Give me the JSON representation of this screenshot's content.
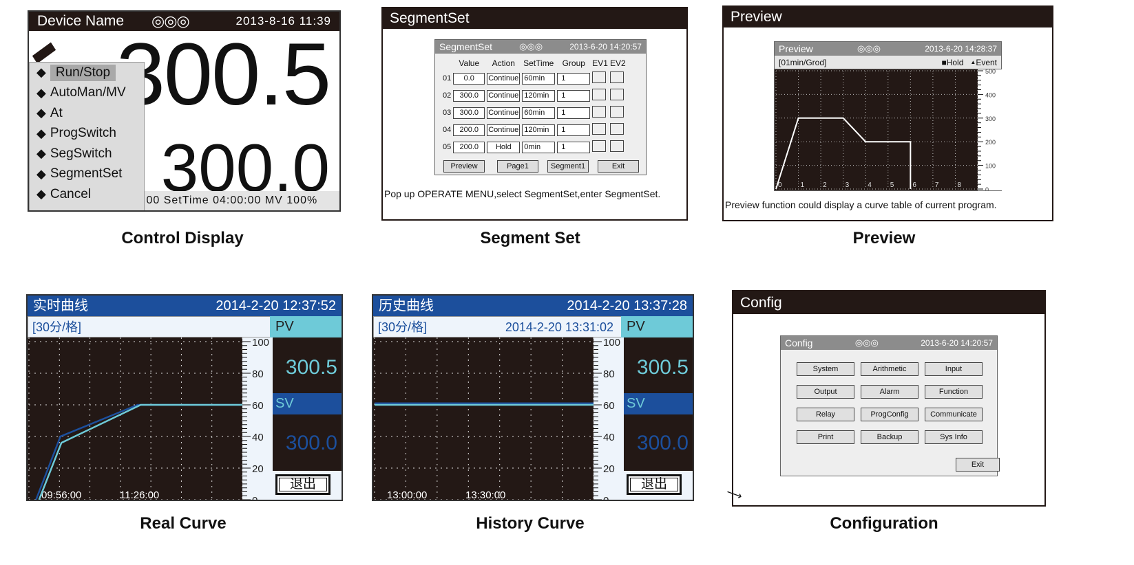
{
  "control_display": {
    "device_name": "Device Name",
    "status_icons": "◎◎◎",
    "datetime": "2013-8-16 11:39",
    "pv": "300.5",
    "sv": "300.0",
    "status_line": ":00  SetTime 04:00:00  MV 100%",
    "menu_items": [
      "Run/Stop",
      "AutoMan/MV",
      "At",
      "ProgSwitch",
      "SegSwitch",
      "SegmentSet",
      "Cancel"
    ],
    "selected_item": "Run/Stop",
    "caption": "Control Display"
  },
  "segment_set": {
    "window_title": "SegmentSet",
    "dialog_title": "SegmentSet",
    "status_icons": "◎◎◎",
    "datetime": "2013-6-20 14:20:57",
    "columns": [
      "",
      "Value",
      "Action",
      "SetTime",
      "Group",
      "EV1",
      "EV2"
    ],
    "rows": [
      {
        "no": "01",
        "value": "0.0",
        "action": "Continue",
        "settime": "60min",
        "group": "1",
        "ev1": false,
        "ev2": false
      },
      {
        "no": "02",
        "value": "300.0",
        "action": "Continue",
        "settime": "120min",
        "group": "1",
        "ev1": false,
        "ev2": false
      },
      {
        "no": "03",
        "value": "300.0",
        "action": "Continue",
        "settime": "60min",
        "group": "1",
        "ev1": false,
        "ev2": false
      },
      {
        "no": "04",
        "value": "200.0",
        "action": "Continue",
        "settime": "120min",
        "group": "1",
        "ev1": false,
        "ev2": false
      },
      {
        "no": "05",
        "value": "200.0",
        "action": "Hold",
        "settime": "0min",
        "group": "1",
        "ev1": false,
        "ev2": false
      }
    ],
    "buttons": [
      "Preview",
      "Page1",
      "Segment1",
      "Exit"
    ],
    "note": "Pop up OPERATE MENU,select SegmentSet,enter SegmentSet.",
    "caption": "Segment Set"
  },
  "preview": {
    "window_title": "Preview",
    "dialog_title": "Preview",
    "status_icons": "◎◎◎",
    "datetime": "2013-6-20 14:28:37",
    "scale": "[01min/Grod]",
    "legend_hold": "Hold",
    "legend_event": "Event",
    "note": "Preview function could display a curve table of current program.",
    "caption": "Preview"
  },
  "real_curve": {
    "title": "实时曲线",
    "datetime": "2014-2-20 12:37:52",
    "scale": "[30分/格]",
    "pv_label": "PV",
    "pv_value": "300.5",
    "sv_label": "SV",
    "sv_value": "300.0",
    "exit_label": "退出",
    "caption": "Real Curve"
  },
  "history_curve": {
    "title": "历史曲线",
    "datetime": "2014-2-20 13:37:28",
    "scale": "[30分/格]",
    "cursor_time": "2014-2-20 13:31:02",
    "pv_label": "PV",
    "pv_value": "300.5",
    "sv_label": "SV",
    "sv_value": "300.0",
    "exit_label": "退出",
    "caption": "History Curve"
  },
  "config": {
    "window_title": "Config",
    "dialog_title": "Config",
    "status_icons": "◎◎◎",
    "datetime": "2013-6-20 14:20:57",
    "buttons": [
      "System",
      "Arithmetic",
      "Input",
      "Output",
      "Alarm",
      "Function",
      "Relay",
      "ProgConfig",
      "Communicate",
      "Print",
      "Backup",
      "Sys Info"
    ],
    "exit_label": "Exit",
    "caption": "Configuration"
  },
  "colors": {
    "header_blue": "#1c4f9c",
    "pv_cyan": "#6ecad8",
    "screen_dark": "#231815"
  },
  "chart_data": [
    {
      "type": "line",
      "name_ref": "preview",
      "x_ticks": [
        "0",
        "1",
        "2",
        "3",
        "4",
        "5",
        "6",
        "7",
        "8"
      ],
      "y_ticks": [
        "0",
        "100",
        "200",
        "300",
        "400",
        "500"
      ],
      "ylim": [
        0,
        500
      ],
      "xlim": [
        0,
        9
      ],
      "grid": true,
      "series": [
        {
          "color": "#ffffff",
          "points": [
            [
              0,
              0
            ],
            [
              1,
              300
            ],
            [
              3,
              300
            ],
            [
              4,
              200
            ],
            [
              6,
              200
            ],
            [
              6,
              0
            ]
          ]
        }
      ]
    },
    {
      "type": "line",
      "name_ref": "real_curve",
      "x_tick_labels": [
        {
          "at": "09:56:00"
        },
        {
          "at": "11:26:00"
        }
      ],
      "x_unit_minutes_per_grid": 30,
      "xlim_minutes": [
        "09:26",
        "12:56"
      ],
      "y_ticks": [
        "0",
        "20",
        "40",
        "60",
        "80",
        "100"
      ],
      "ylim": [
        0,
        100
      ],
      "grid": true,
      "series": [
        {
          "color": "#1c4f9c",
          "points": [
            [
              "09:33",
              0
            ],
            [
              "09:57",
              40
            ],
            [
              "11:13",
              60
            ],
            [
              "12:56",
              60
            ]
          ]
        },
        {
          "color": "#6ecad8",
          "points": [
            [
              "09:36",
              0
            ],
            [
              "09:58",
              36
            ],
            [
              "11:16",
              60
            ],
            [
              "12:56",
              60
            ]
          ]
        }
      ]
    },
    {
      "type": "line",
      "name_ref": "history_curve",
      "x_tick_labels": [
        {
          "at": "13:00:00"
        },
        {
          "at": "13:30:00"
        }
      ],
      "y_ticks": [
        "0",
        "20",
        "40",
        "60",
        "80",
        "100"
      ],
      "ylim": [
        0,
        100
      ],
      "grid": true,
      "series": [
        {
          "color": "#1c4f9c",
          "level": 61
        },
        {
          "color": "#6ecad8",
          "level": 60
        }
      ]
    }
  ]
}
